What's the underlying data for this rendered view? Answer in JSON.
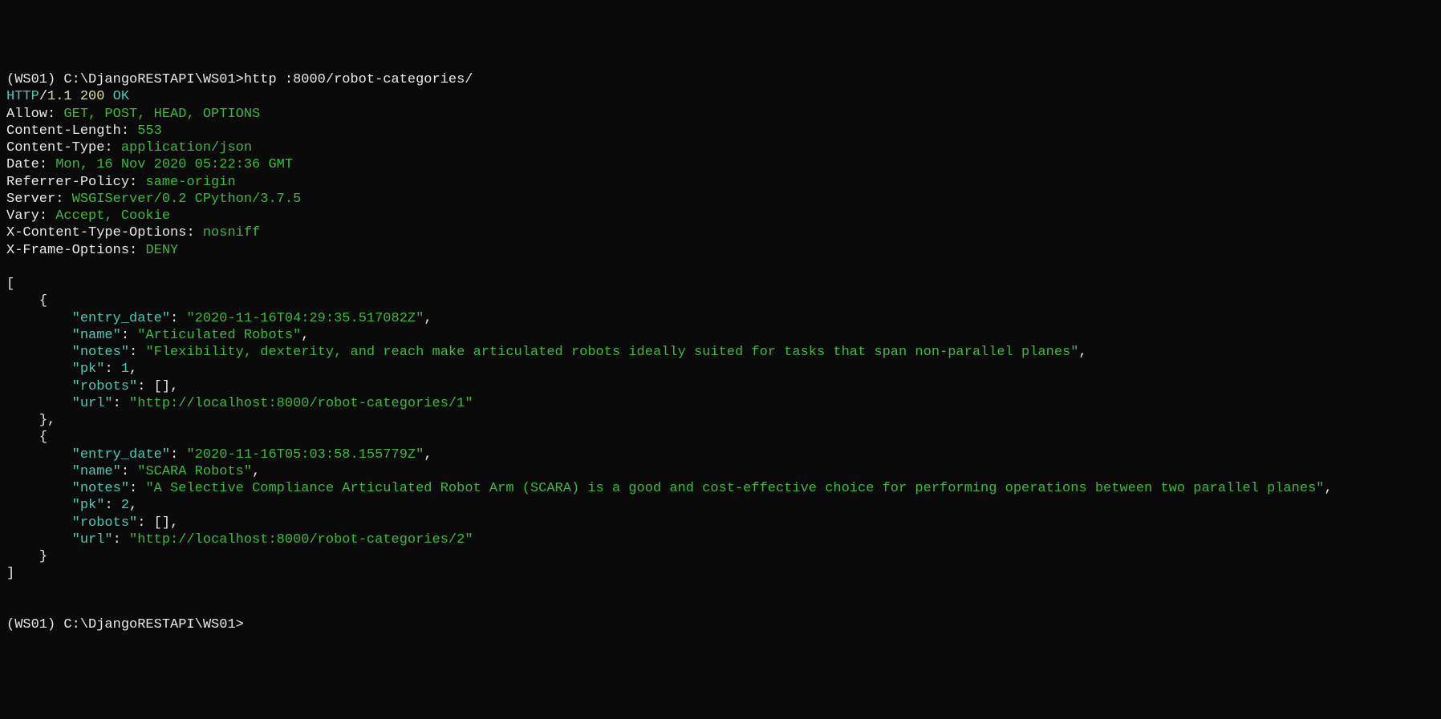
{
  "prompt": {
    "line1_prefix": "(WS01) C:\\DjangoRESTAPI\\WS01>",
    "line1_command": "http :8000/robot-categories/",
    "final_prompt": "(WS01) C:\\DjangoRESTAPI\\WS01>"
  },
  "http_response": {
    "protocol": "HTTP",
    "slash": "/",
    "version": "1.1",
    "status_code": "200",
    "status_text": "OK"
  },
  "headers": [
    {
      "name": "Allow",
      "value": "GET, POST, HEAD, OPTIONS"
    },
    {
      "name": "Content-Length",
      "value": "553"
    },
    {
      "name": "Content-Type",
      "value": "application/json"
    },
    {
      "name": "Date",
      "value": "Mon, 16 Nov 2020 05:22:36 GMT"
    },
    {
      "name": "Referrer-Policy",
      "value": "same-origin"
    },
    {
      "name": "Server",
      "value": "WSGIServer/0.2 CPython/3.7.5"
    },
    {
      "name": "Vary",
      "value": "Accept, Cookie"
    },
    {
      "name": "X-Content-Type-Options",
      "value": "nosniff"
    },
    {
      "name": "X-Frame-Options",
      "value": "DENY"
    }
  ],
  "json_body": [
    {
      "entry_date": "\"2020-11-16T04:29:35.517082Z\"",
      "name": "\"Articulated Robots\"",
      "notes": "\"Flexibility, dexterity, and reach make articulated robots ideally suited for tasks that span non-parallel planes\"",
      "pk": "1",
      "robots": "[]",
      "url": "\"http://localhost:8000/robot-categories/1\""
    },
    {
      "entry_date": "\"2020-11-16T05:03:58.155779Z\"",
      "name": "\"SCARA Robots\"",
      "notes": "\"A Selective Compliance Articulated Robot Arm (SCARA) is a good and cost-effective choice for performing operations between two parallel planes\"",
      "pk": "2",
      "robots": "[]",
      "url": "\"http://localhost:8000/robot-categories/2\""
    }
  ],
  "json_keys": {
    "entry_date": "\"entry_date\"",
    "name": "\"name\"",
    "notes": "\"notes\"",
    "pk": "\"pk\"",
    "robots": "\"robots\"",
    "url": "\"url\""
  },
  "punct": {
    "colon_space": ": ",
    "comma": ",",
    "open_bracket": "[",
    "close_bracket": "]",
    "open_brace": "{",
    "close_brace": "}",
    "space": " "
  }
}
